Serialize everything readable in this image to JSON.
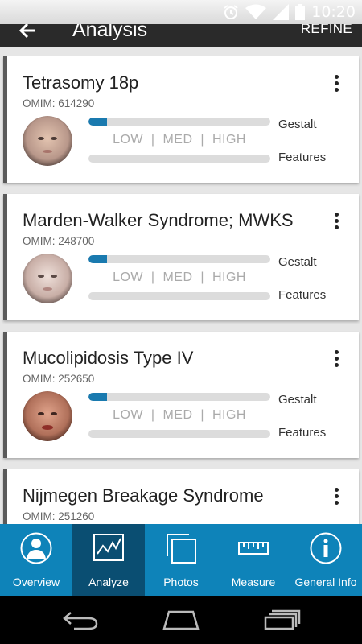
{
  "status_bar": {
    "time": "10:20"
  },
  "app_bar": {
    "title": "Analysis",
    "action": "REFINE"
  },
  "colors": {
    "accent": "#0e83b9",
    "nav_active": "#0a4e72",
    "bar_fill": "#1a7aaf"
  },
  "scale_text": "LOW  |  MED  |  HIGH",
  "bar_labels": {
    "gestalt": "Gestalt",
    "features": "Features"
  },
  "results": [
    {
      "title": "Tetrasomy 18p",
      "omim": "OMIM: 614290",
      "gestalt_level": 0.1,
      "features_level": 0
    },
    {
      "title": "Marden-Walker Syndrome; MWKS",
      "omim": "OMIM: 248700",
      "gestalt_level": 0.1,
      "features_level": 0
    },
    {
      "title": "Mucolipidosis Type IV",
      "omim": "OMIM: 252650",
      "gestalt_level": 0.1,
      "features_level": 0
    },
    {
      "title": "Nijmegen Breakage Syndrome",
      "omim": "OMIM: 251260",
      "gestalt_level": 0.1,
      "features_level": 0
    }
  ],
  "bottom_nav": [
    {
      "label": "Overview",
      "icon": "person-icon",
      "active": false
    },
    {
      "label": "Analyze",
      "icon": "chart-icon",
      "active": true
    },
    {
      "label": "Photos",
      "icon": "photos-icon",
      "active": false
    },
    {
      "label": "Measure",
      "icon": "ruler-icon",
      "active": false
    },
    {
      "label": "General Info",
      "icon": "info-icon",
      "active": false
    }
  ]
}
